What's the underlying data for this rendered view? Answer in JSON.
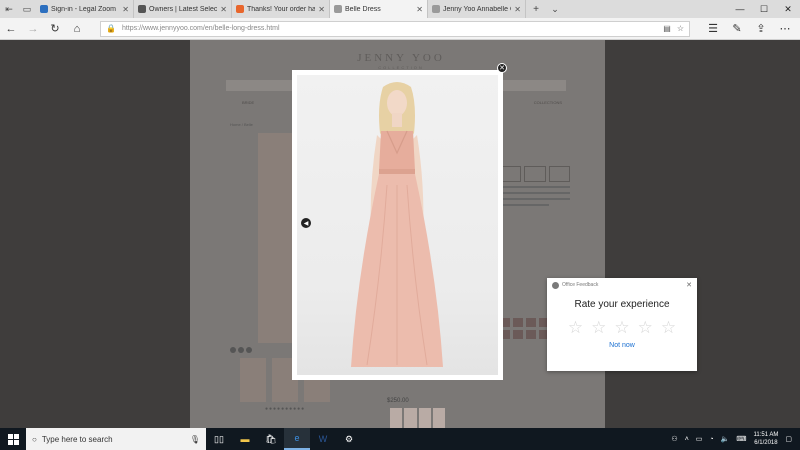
{
  "browser": {
    "tabs": [
      {
        "label": "Sign-in - Legal Zoom",
        "icon_color": "#2c6fbf",
        "active": false
      },
      {
        "label": "Owners | Latest Selected Jr",
        "icon_color": "#555555",
        "active": false
      },
      {
        "label": "Thanks! Your order has been",
        "icon_color": "#e8662c",
        "active": false
      },
      {
        "label": "Belle Dress",
        "icon_color": "#9a9a9a",
        "active": true
      },
      {
        "label": "Jenny Yoo Annabelle Convertible",
        "icon_color": "#9a9a9a",
        "active": false
      }
    ],
    "new_tab_icon": "plus-icon",
    "url": "https://www.jennyyoo.com/en/belle-long-dress.html",
    "window_controls": [
      "minimize-icon",
      "maximize-icon",
      "close-icon"
    ]
  },
  "site": {
    "logo": "JENNY YOO",
    "logo_sub": "COLLECTION",
    "menu": [
      "BRIDE",
      "BRIDESMAIDS",
      "BRIDAL",
      "LITTLE WHITE DRESS",
      "COLLECTIONS"
    ],
    "crumb": "Home / Belle",
    "price": "$250.00"
  },
  "lightbox": {
    "close_icon": "close-icon",
    "prev_icon": "chevron-left-icon",
    "dress_color": "#eab9aa"
  },
  "rating": {
    "source": "Office Feedback",
    "title": "Rate your experience",
    "stars": 5,
    "later": "Not now"
  },
  "taskbar": {
    "search_placeholder": "Type here to search",
    "apps": [
      "task-view-icon",
      "file-explorer-icon",
      "store-icon",
      "edge-icon",
      "word-icon",
      "settings-icon"
    ],
    "active_app": "edge-icon",
    "time": "11:51 AM",
    "date": "6/1/2018"
  }
}
